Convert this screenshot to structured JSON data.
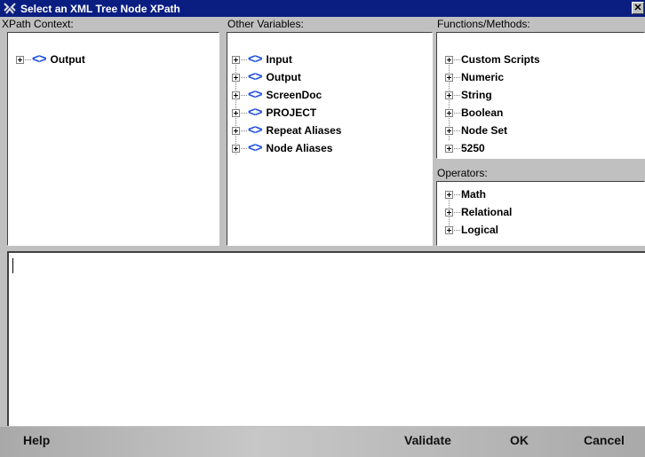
{
  "window": {
    "title": "Select an XML Tree Node XPath",
    "close_glyph": "✕"
  },
  "xpath_context": {
    "label": "XPath Context:",
    "items": [
      {
        "label": "Output",
        "node_glyph": "<>"
      }
    ]
  },
  "other_variables": {
    "label": "Other Variables:",
    "items": [
      {
        "label": "Input",
        "node_glyph": "<>"
      },
      {
        "label": "Output",
        "node_glyph": "<>"
      },
      {
        "label": "ScreenDoc",
        "node_glyph": "<>"
      },
      {
        "label": "PROJECT",
        "node_glyph": "<>"
      },
      {
        "label": "Repeat Aliases",
        "node_glyph": "<>"
      },
      {
        "label": "Node Aliases",
        "node_glyph": "<>"
      }
    ]
  },
  "functions": {
    "label": "Functions/Methods:",
    "items": [
      {
        "label": "Custom Scripts"
      },
      {
        "label": "Numeric"
      },
      {
        "label": "String"
      },
      {
        "label": "Boolean"
      },
      {
        "label": "Node Set"
      },
      {
        "label": "5250"
      }
    ]
  },
  "operators": {
    "label": "Operators:",
    "items": [
      {
        "label": "Math"
      },
      {
        "label": "Relational"
      },
      {
        "label": "Logical"
      }
    ]
  },
  "editor": {
    "value": ""
  },
  "footer": {
    "help_label": "Help",
    "validate_label": "Validate",
    "ok_label": "OK",
    "cancel_label": "Cancel"
  },
  "colors": {
    "title_bar": "#0a1e82",
    "node_icon": "#1f4fe0",
    "background": "#c0c0c0"
  }
}
